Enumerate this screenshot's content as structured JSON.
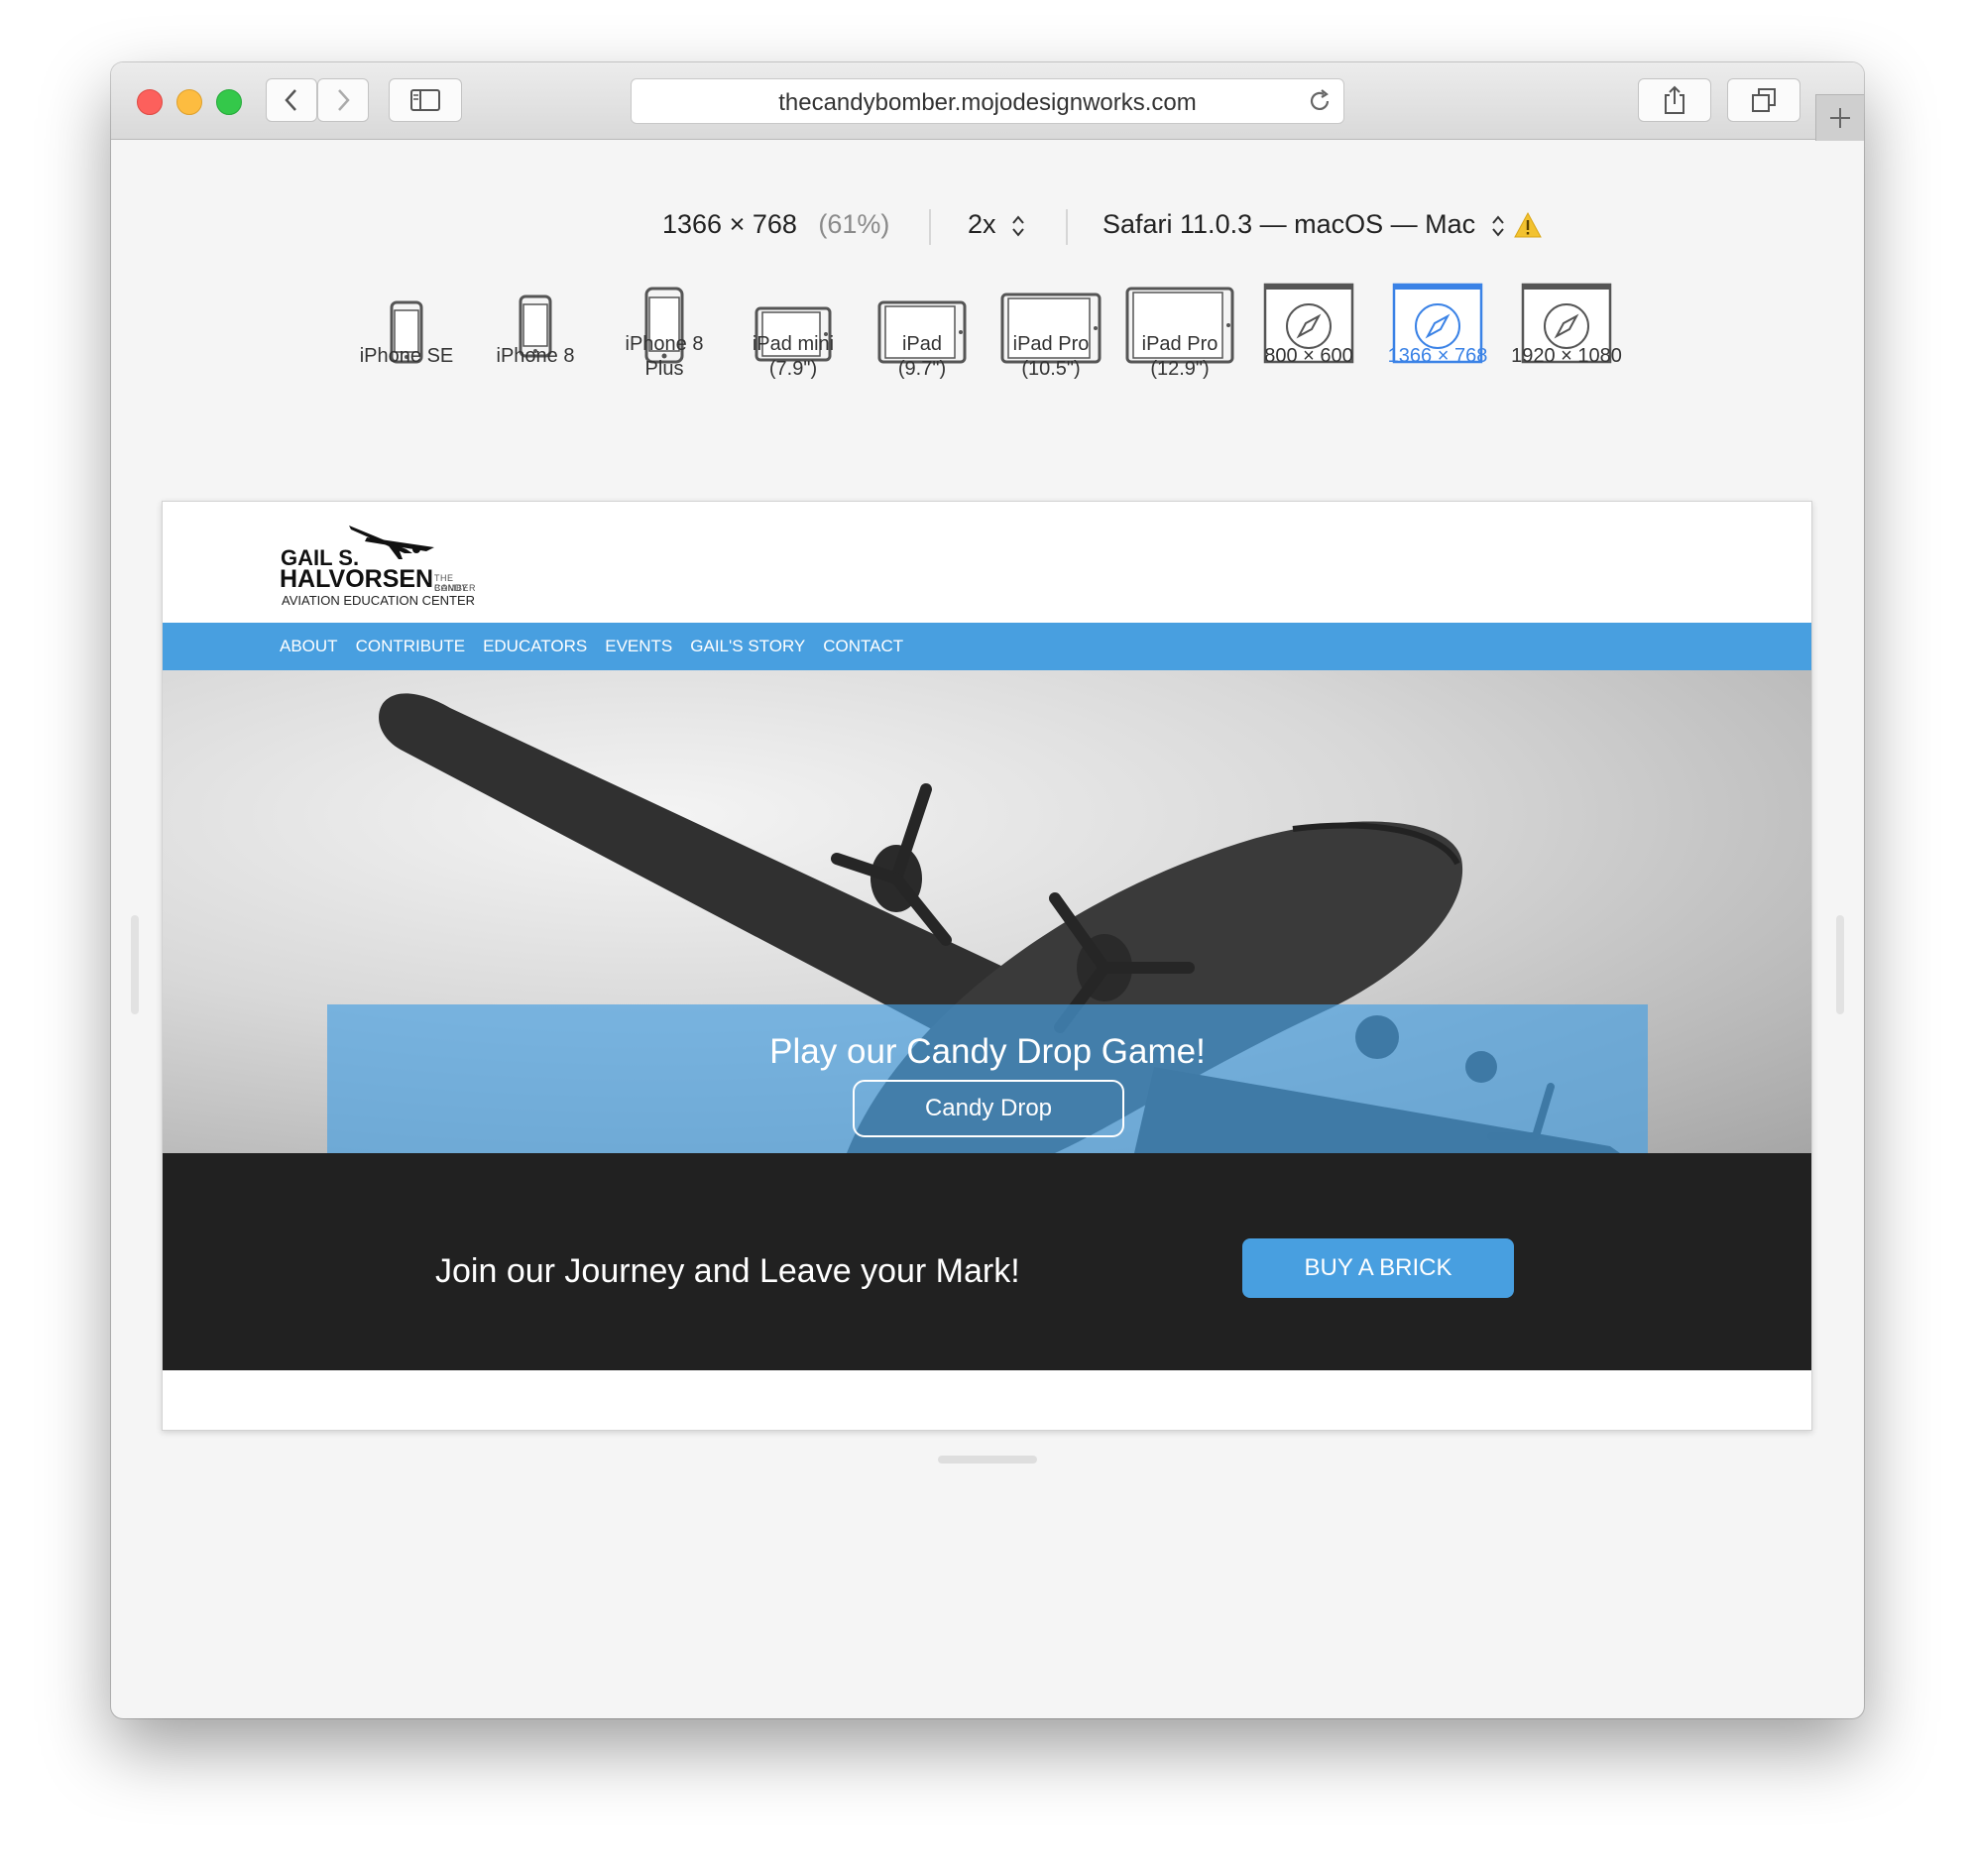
{
  "browser": {
    "url": "thecandybomber.mojodesignworks.com",
    "icons": [
      "back-icon",
      "forward-icon",
      "sidebar-icon",
      "reload-icon",
      "share-icon",
      "tabs-icon",
      "plus-icon"
    ]
  },
  "responsive_toolbar": {
    "dimensions": "1366 × 768",
    "percent": "(61%)",
    "scale": "2x",
    "browser": "Safari 11.0.3 — macOS — Mac",
    "warning_icon": "warning-icon"
  },
  "devices": [
    {
      "label": "iPhone SE",
      "icon": "phone-icon"
    },
    {
      "label": "iPhone 8",
      "icon": "phone-icon"
    },
    {
      "label": "iPhone 8\nPlus",
      "icon": "phone-icon"
    },
    {
      "label": "iPad mini\n(7.9\")",
      "icon": "tablet-icon"
    },
    {
      "label": "iPad\n(9.7\")",
      "icon": "tablet-icon"
    },
    {
      "label": "iPad Pro\n(10.5\")",
      "icon": "tablet-icon"
    },
    {
      "label": "iPad Pro\n(12.9\")",
      "icon": "tablet-icon"
    },
    {
      "label": "800 × 600",
      "icon": "safari-window-icon"
    },
    {
      "label": "1366 × 768",
      "icon": "safari-window-icon",
      "active": true
    },
    {
      "label": "1920 × 1080",
      "icon": "safari-window-icon"
    }
  ],
  "site": {
    "logo": {
      "line1": "GAIL S.",
      "line2": "HALVORSEN",
      "sub1": "THE CANDY",
      "sub2": "BOMBER",
      "line3": "AVIATION EDUCATION CENTER"
    },
    "nav": [
      "ABOUT",
      "CONTRIBUTE",
      "EDUCATORS",
      "EVENTS",
      "GAIL'S STORY",
      "CONTACT"
    ],
    "promo_title": "Play our Candy Drop Game!",
    "promo_button": "Candy Drop",
    "cta_text": "Join our Journey and Leave your Mark!",
    "cta_button": "BUY A BRICK"
  },
  "colors": {
    "accent_blue": "#489fe0",
    "active_blue": "#3a82e6",
    "dark_band": "#212121"
  }
}
